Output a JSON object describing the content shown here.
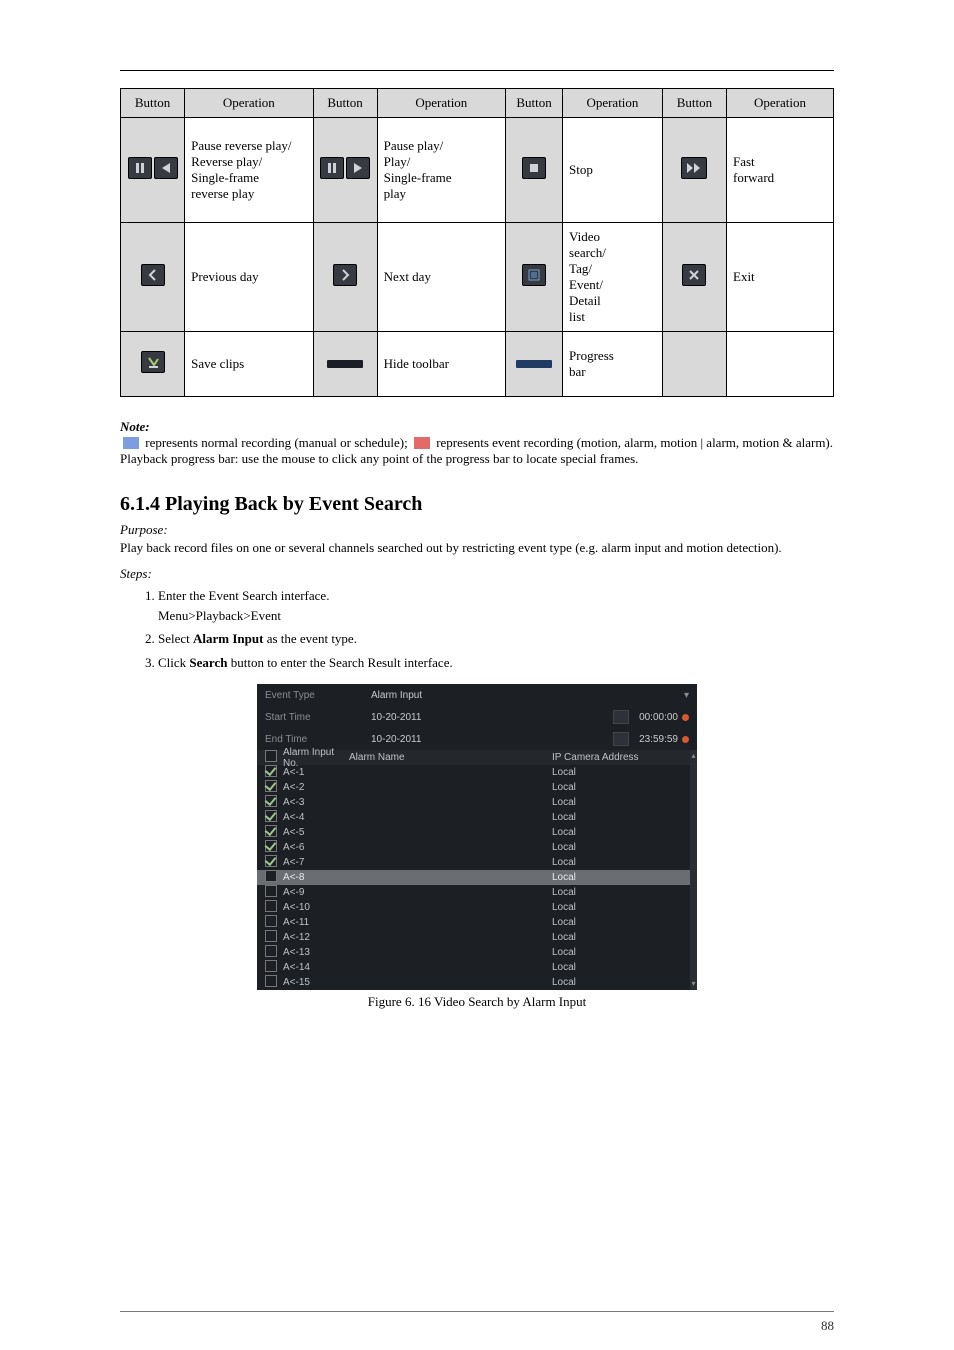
{
  "page_number": "88",
  "table": {
    "headers": [
      "Button",
      "Operation",
      "Button",
      "Operation",
      "Button",
      "Operation",
      "Button",
      "Operation"
    ],
    "rows": [
      {
        "c1": {
          "name": "pause-rev-play",
          "d": "Pause reverse play/\nReverse play/\nSingle-frame\nreverse play"
        },
        "c2": {
          "name": "pause-play",
          "d": "Pause play/\nPlay/\nSingle-frame\nplay"
        },
        "c3": {
          "name": "stop",
          "d": "Stop"
        },
        "c4": {
          "name": "fast-forward",
          "d": "Fast\nforward"
        }
      },
      {
        "c1": {
          "name": "prev-day",
          "d": "Previous day"
        },
        "c2": {
          "name": "next-day",
          "d": "Next day"
        },
        "c3": {
          "name": "detail-list",
          "d": "Video\nsearch/\nTag/\nEvent/\nDetail\nlist"
        },
        "c4": {
          "name": "exit",
          "d": "Exit"
        }
      },
      {
        "c1": {
          "name": "save-clips",
          "d": "Save clips"
        },
        "c2": {
          "name": "hide-bar",
          "d": "Hide toolbar"
        },
        "c3": {
          "name": "progress-bar",
          "d": "Progress\nbar"
        },
        "c4": {
          "name": "empty",
          "d": ""
        }
      }
    ]
  },
  "note_label": "Note:",
  "note_segments": {
    "a": " represents normal recording (manual or schedule); ",
    "b": " represents event recording (motion, alarm, motion | alarm, motion & alarm).",
    "c": "Playback progress bar: use the mouse to click any point of the progress bar to locate special frames."
  },
  "section": {
    "heading": "6.1.4 Playing Back by Event Search",
    "purpose_label": "Purpose:",
    "purpose": "Play back record files on one or several channels searched out by restricting event type (e.g. alarm input and motion detection).",
    "steps_label": "Steps:",
    "steps": [
      "Enter the Event Search interface.\nMenu>Playback>Event",
      "Select Alarm Input as the event type.",
      "Click Search button to enter the Search Result interface."
    ],
    "step1_menu_path": "Menu>Playback>Event",
    "step2_phrase_pre": "Select ",
    "step2_bold": "Alarm Input",
    "step2_phrase_post": " as the event type.",
    "step3_phrase_pre": "Click ",
    "step3_bold": "Search",
    "step3_phrase_post": " button to enter the Search Result interface."
  },
  "screenshot": {
    "caption": "Figure 6. 16 Video Search by Alarm Input",
    "fields": {
      "event_type_label": "Event Type",
      "event_type_value": "Alarm Input",
      "start_time_label": "Start Time",
      "start_date": "10-20-2011",
      "start_time": "00:00:00",
      "end_time_label": "End Time",
      "end_date": "10-20-2011",
      "end_time": "23:59:59",
      "col_alarm_no": "Alarm Input No.",
      "col_alarm_name": "Alarm Name",
      "col_ip": "IP Camera Address",
      "loc": "Local"
    },
    "alarms": [
      {
        "no": "A<-1",
        "checked": true
      },
      {
        "no": "A<-2",
        "checked": true
      },
      {
        "no": "A<-3",
        "checked": true
      },
      {
        "no": "A<-4",
        "checked": true
      },
      {
        "no": "A<-5",
        "checked": true
      },
      {
        "no": "A<-6",
        "checked": true
      },
      {
        "no": "A<-7",
        "checked": true
      },
      {
        "no": "A<-8",
        "checked": false,
        "sel": true
      },
      {
        "no": "A<-9",
        "checked": false
      },
      {
        "no": "A<-10",
        "checked": false
      },
      {
        "no": "A<-11",
        "checked": false
      },
      {
        "no": "A<-12",
        "checked": false
      },
      {
        "no": "A<-13",
        "checked": false
      },
      {
        "no": "A<-14",
        "checked": false
      },
      {
        "no": "A<-15",
        "checked": false
      }
    ]
  }
}
